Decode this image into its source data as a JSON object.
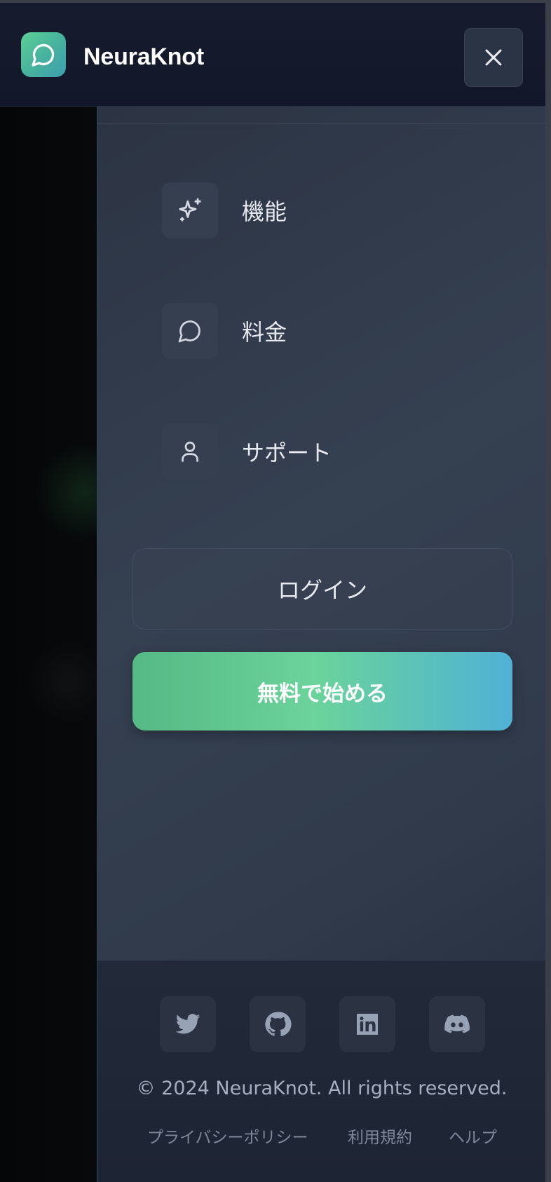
{
  "app": {
    "brand": "NeuraKnot"
  },
  "nav": {
    "items": [
      {
        "label": "機能",
        "icon": "sparkles-icon"
      },
      {
        "label": "料金",
        "icon": "chat-bubble-icon"
      },
      {
        "label": "サポート",
        "icon": "user-icon"
      }
    ]
  },
  "actions": {
    "login_label": "ログイン",
    "start_label": "無料で始める"
  },
  "footer": {
    "social": [
      "twitter-icon",
      "github-icon",
      "linkedin-icon",
      "discord-icon"
    ],
    "copyright": "© 2024 NeuraKnot. All rights reserved.",
    "links": [
      "プライバシーポリシー",
      "利用規約",
      "ヘルプ"
    ]
  },
  "colors": {
    "accent_start": "#55b985",
    "accent_mid": "#6bd39b",
    "accent_end": "#51b1d6",
    "header_bg": "#141a2b",
    "drawer_bg": "#343e4f"
  }
}
